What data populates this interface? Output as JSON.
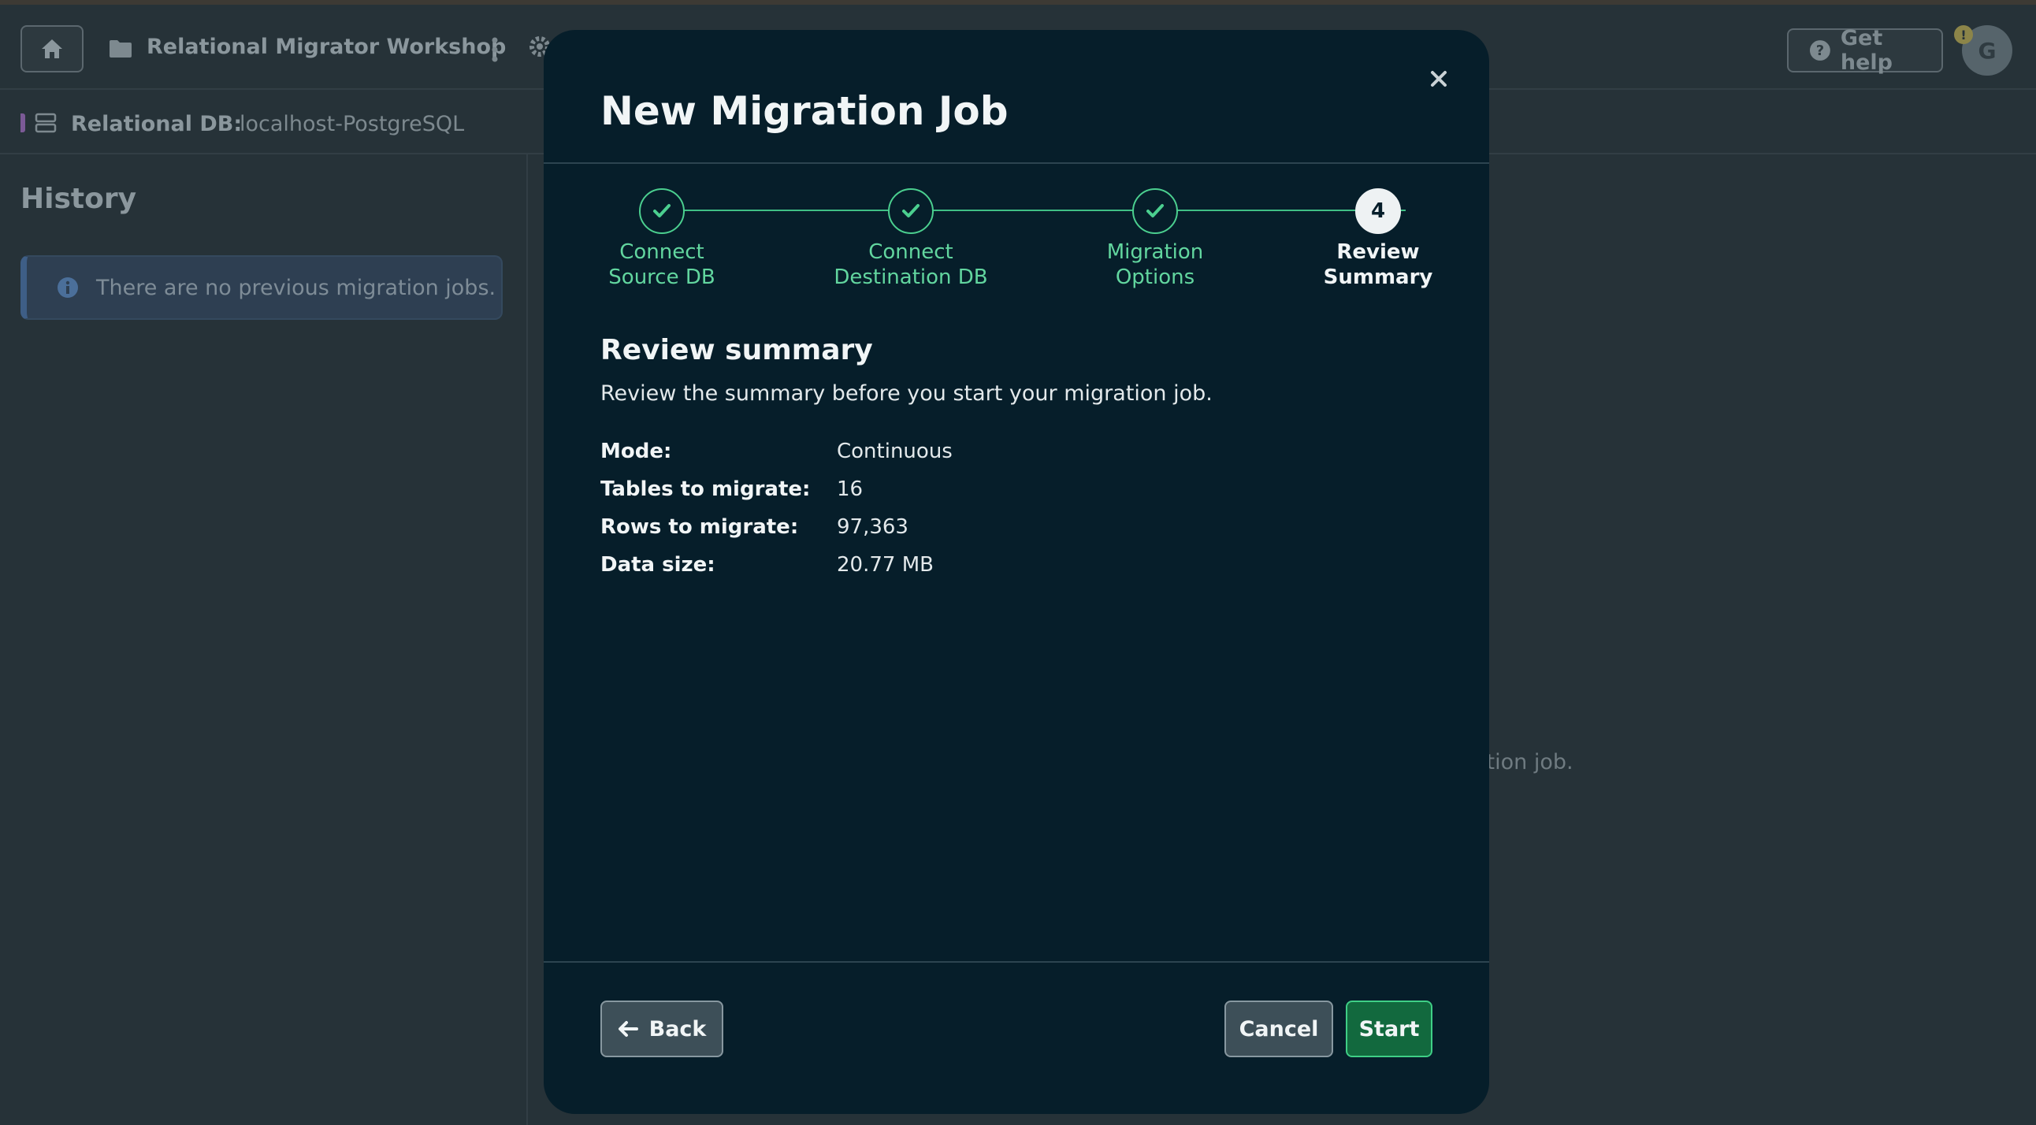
{
  "topbar": {
    "project_name": "Relational Migrator Workshop",
    "help_label": "Get help",
    "avatar_initial": "G",
    "alert_glyph": "!"
  },
  "dbbar": {
    "label": "Relational DB:",
    "value": "localhost-PostgreSQL"
  },
  "sidebar": {
    "title": "History",
    "info_message": "There are no previous migration jobs."
  },
  "background": {
    "hint_text": "ation job."
  },
  "modal": {
    "title": "New Migration Job",
    "steps": [
      {
        "line1": "Connect",
        "line2": "Source DB",
        "state": "done"
      },
      {
        "line1": "Connect",
        "line2": "Destination DB",
        "state": "done"
      },
      {
        "line1": "Migration",
        "line2": "Options",
        "state": "done"
      },
      {
        "line1": "Review",
        "line2": "Summary",
        "state": "active",
        "number": "4"
      }
    ],
    "section_title": "Review summary",
    "section_desc": "Review the summary before you start your migration job.",
    "summary": [
      {
        "key": "Mode:",
        "value": "Continuous"
      },
      {
        "key": "Tables to migrate:",
        "value": "16"
      },
      {
        "key": "Rows to migrate:",
        "value": "97,363"
      },
      {
        "key": "Data size:",
        "value": "20.77 MB"
      }
    ],
    "buttons": {
      "back": "Back",
      "cancel": "Cancel",
      "start": "Start"
    }
  },
  "colors": {
    "background": "#263238",
    "modal": "#061e2a",
    "accent_green": "#4bcf8f",
    "start_button": "#12693e"
  },
  "icons": [
    "home-icon",
    "folder-icon",
    "kebab-menu-icon",
    "gear-icon",
    "help-icon",
    "database-icon",
    "info-icon",
    "close-icon",
    "check-icon",
    "arrow-left-icon"
  ]
}
